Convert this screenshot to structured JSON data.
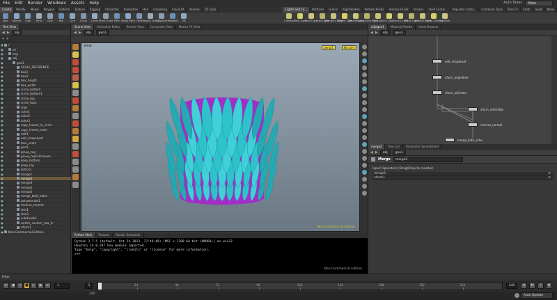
{
  "menu": [
    "File",
    "Edit",
    "Render",
    "Windows",
    "Assets",
    "Help"
  ],
  "top_right": {
    "auto_takes": "Auto Takes",
    "desktop": "Main"
  },
  "shelf_tabs_left": [
    "Create",
    "Modify",
    "Model",
    "Polygon",
    "Deform",
    "Texture",
    "Rigging",
    "Character",
    "Animation",
    "Hair",
    "Grooming",
    "Cloud FX",
    "Volume",
    "TD Tools"
  ],
  "shelf_tools_left": [
    "Box",
    "Sphere",
    "Tube",
    "Torus",
    "Grid",
    "Null",
    "Line",
    "Circle",
    "Curve",
    "Draw Curve",
    "Path",
    "Spray Paint",
    "Font",
    "Platonic Solids",
    "L-System",
    "Metaball",
    "File"
  ],
  "shelf_tabs_right": [
    "Lights and Ca...",
    "Particles",
    "Grains",
    "Rigid Bodies",
    "Particle Fluids",
    "Viscous Fluids",
    "Oceans",
    "Fluid Contai...",
    "Populate Conta...",
    "Container Tools",
    "Pyro FX",
    "Cloth",
    "Solid",
    "Wires",
    "Crowds",
    "Drive Simulati..."
  ],
  "shelf_tools_right": [
    "Camera",
    "Point Light",
    "Spot Light",
    "Area Light",
    "Geometry Light",
    "Volume Light",
    "Distant Light",
    "Environment Light",
    "Sky Light",
    "GI Light",
    "Caustic Light",
    "Portal Light",
    "Ambient Light",
    "Stereo Camera",
    "Switcher"
  ],
  "left_panel": {
    "tabs": [
      "Tree View"
    ],
    "path": "obj",
    "tree": [
      {
        "label": "/",
        "indent": 0
      },
      {
        "label": "ch",
        "indent": 1
      },
      {
        "label": "img",
        "indent": 1
      },
      {
        "label": "obj",
        "indent": 1
      },
      {
        "label": "geo1",
        "indent": 2
      },
      {
        "label": "SCALE_REFERENCE",
        "indent": 3
      },
      {
        "label": "box1",
        "indent": 3
      },
      {
        "label": "box2",
        "indent": 3
      },
      {
        "label": "box_height",
        "indent": 3
      },
      {
        "label": "box_width",
        "indent": 3
      },
      {
        "label": "circle_bottom",
        "indent": 3
      },
      {
        "label": "circle_bottom1",
        "indent": 3
      },
      {
        "label": "circle_top",
        "indent": 3
      },
      {
        "label": "circle_top1",
        "indent": 3
      },
      {
        "label": "clip1",
        "indent": 3
      },
      {
        "label": "color1",
        "indent": 3
      },
      {
        "label": "color2",
        "indent": 3
      },
      {
        "label": "color3",
        "indent": 3
      },
      {
        "label": "copy_leaves_in_circle",
        "indent": 3
      },
      {
        "label": "copy_leaves_rows",
        "indent": 3
      },
      {
        "label": "edit1",
        "indent": 3
      },
      {
        "label": "edit_shapeLeaf",
        "indent": 3
      },
      {
        "label": "fuse_seam",
        "indent": 3
      },
      {
        "label": "grid1",
        "indent": 3
      },
      {
        "label": "group_top",
        "indent": 3
      },
      {
        "label": "group_topFullLeaves",
        "indent": 3
      },
      {
        "label": "keep_bottom",
        "indent": 3
      },
      {
        "label": "keep_top",
        "indent": 3
      },
      {
        "label": "lattice1",
        "indent": 3
      },
      {
        "label": "merge1",
        "indent": 3
      },
      {
        "label": "merge2",
        "indent": 3,
        "selected": true
      },
      {
        "label": "merge3",
        "indent": 3
      },
      {
        "label": "merge4",
        "indent": 3
      },
      {
        "label": "merge5",
        "indent": 3
      },
      {
        "label": "merge_both_sides",
        "indent": 3
      },
      {
        "label": "polyextrude1",
        "indent": 3
      },
      {
        "label": "reverse_normal",
        "indent": 3
      },
      {
        "label": "skin1",
        "indent": 3
      },
      {
        "label": "skin2",
        "indent": 3
      },
      {
        "label": "subdivide1",
        "indent": 3
      },
      {
        "label": "switch_custom_row_tr",
        "indent": 3
      },
      {
        "label": "xform1",
        "indent": 3
      },
      {
        "label": "Non-Commercial Edition",
        "indent": 0
      }
    ]
  },
  "viewport": {
    "tabs": [
      "Scene View",
      "Animation Editor",
      "Render View",
      "Composite View",
      "Motion FX View"
    ],
    "path": [
      "obj",
      "geo1"
    ],
    "title": "View",
    "camera": "persp1",
    "cam_menu": "No cam",
    "nce": "Non-Commercial Edition",
    "leaf_color": "#2ec3cc",
    "inner_color": "#a52cc7"
  },
  "python": {
    "tabs": [
      "Python Shell",
      "Textport",
      "Render Scheduler"
    ],
    "lines": [
      "Python 2.7.5 (default, Oct 24 2013, 17:49:49) [MSC v.1700 64 bit (AMD64)] on win32",
      "Houdini 14.0.287 hou module imported.",
      "Type \"help\", \"copyright\", \"credits\" or \"license\" for more information.",
      ">>>"
    ],
    "nce": "Non-Commercial Edition"
  },
  "network": {
    "tabs": [
      "/obj/geo1",
      "Material Palette",
      "Asset Browser"
    ],
    "path": [
      "obj",
      "geo1"
    ],
    "nodes": [
      "edit_shapeLeaf",
      "xform_angleSide",
      "xform_toCenter",
      "xform_otherSide",
      "reverse_normal",
      "merge_both_sides"
    ]
  },
  "params": {
    "tabs": [
      "merge2",
      "Tree List",
      "Parameter Spreadsheet"
    ],
    "type": "Merge",
    "name": "merge2",
    "input_label": "Input Operators (Drag/Drop to reorder)",
    "inputs": [
      "merge1",
      "xform1"
    ]
  },
  "playbar": {
    "filter_label": "Filter",
    "frame": "1",
    "start": "1",
    "end": "240",
    "end2": "240",
    "ticks": [
      "24",
      "48",
      "72",
      "96",
      "120",
      "144",
      "168",
      "192",
      "216"
    ],
    "auto_update": "Auto Update"
  }
}
